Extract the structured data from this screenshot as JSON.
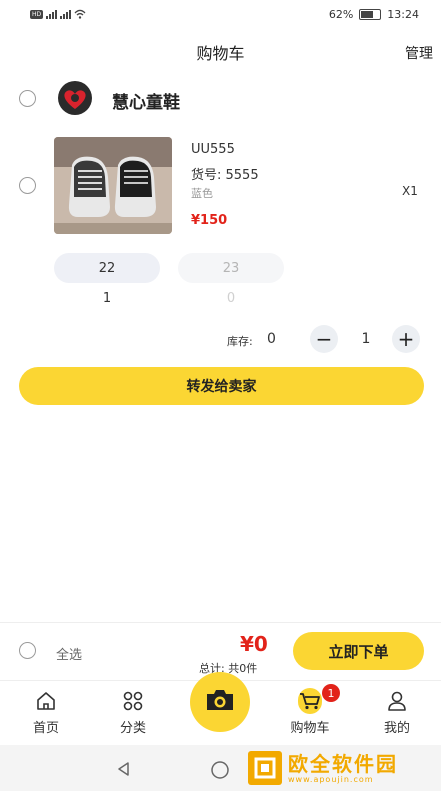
{
  "status_bar": {
    "network": "HD 4G 2G",
    "battery": "62%",
    "time": "13:24"
  },
  "header": {
    "title": "购物车",
    "manage_label": "管理"
  },
  "shop": {
    "name": "慧心童鞋"
  },
  "product": {
    "name": "UU555",
    "code": "货号:  5555",
    "color": "蓝色",
    "quantity": "X1",
    "price": "¥150",
    "sizes": [
      {
        "label": "22",
        "count": "1",
        "active": true
      },
      {
        "label": "23",
        "count": "0",
        "active": false
      }
    ],
    "stock_label": "库存:",
    "stock_value": "0",
    "stepper_minus": "−",
    "stepper_value": "1",
    "stepper_plus": "+"
  },
  "forward_button_label": "转发给卖家",
  "checkout": {
    "select_all_label": "全选",
    "total_price": "¥0",
    "total_label": "总计:  共0件",
    "order_button_label": "立即下单"
  },
  "tabbar": {
    "tabs": [
      {
        "label": "首页",
        "icon": "home-icon"
      },
      {
        "label": "分类",
        "icon": "category-icon"
      },
      {
        "label": "",
        "icon": "camera-icon"
      },
      {
        "label": "购物车",
        "icon": "cart-icon"
      },
      {
        "label": "我的",
        "icon": "profile-icon"
      }
    ],
    "cart_badge": "1"
  },
  "watermark": {
    "title": "欧全软件园",
    "subtitle": "www.apoujin.com"
  },
  "colors": {
    "accent_yellow": "#fbd633",
    "price_red": "#e2231a"
  }
}
